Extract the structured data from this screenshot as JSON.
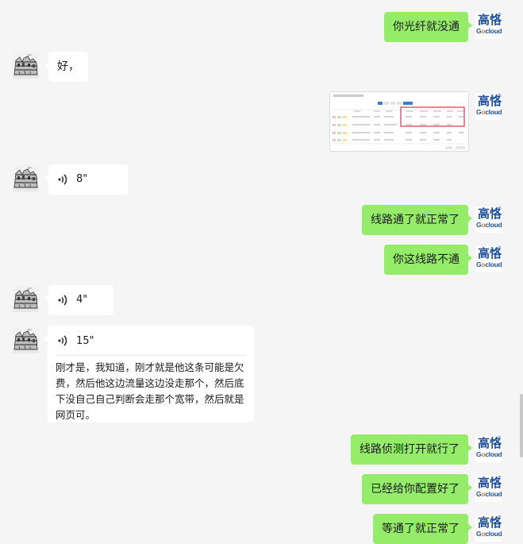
{
  "brand": {
    "cn": "高恪",
    "en_prefix": "G",
    "en_o": "o",
    "en_suffix": "cloud",
    "registered": "®",
    "color": "#1d4f9c"
  },
  "colors": {
    "outgoing_bubble": "#95ec69",
    "incoming_bubble": "#ffffff",
    "background": "#f5f5f5"
  },
  "messages": [
    {
      "side": "out",
      "type": "text",
      "text": "你光纤就没通"
    },
    {
      "side": "in",
      "type": "text",
      "text": "好，"
    },
    {
      "side": "out",
      "type": "image"
    },
    {
      "side": "in",
      "type": "voice",
      "duration": "8\""
    },
    {
      "side": "out",
      "type": "text",
      "text": "线路通了就正常了"
    },
    {
      "side": "out",
      "type": "text",
      "text": "你这线路不通"
    },
    {
      "side": "in",
      "type": "voice",
      "duration": "4\""
    },
    {
      "side": "in",
      "type": "voice_transcript",
      "duration": "15\"",
      "transcript": "刚才是，我知道，刚才就是他这条可能是欠费，然后他这边流量这边没走那个，然后底下没自己自己判断会走那个宽带，然后就是网页可。"
    },
    {
      "side": "out",
      "type": "text",
      "text": "线路侦测打开就行了"
    },
    {
      "side": "out",
      "type": "text",
      "text": "已经给你配置好了"
    },
    {
      "side": "out",
      "type": "text",
      "text": "等通了就正常了"
    }
  ]
}
